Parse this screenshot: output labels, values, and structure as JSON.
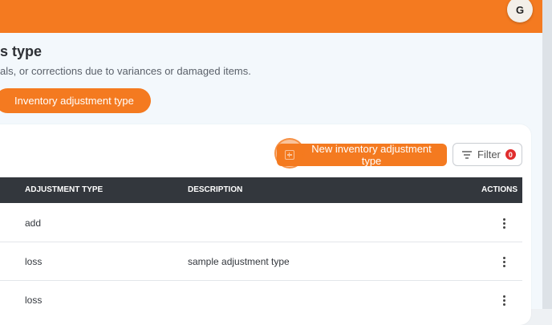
{
  "header": {
    "avatar_initial": "G",
    "brand_color": "#f47a20"
  },
  "page": {
    "title": "s type",
    "description": "als, or corrections due to variances or damaged items."
  },
  "tab_button": {
    "label": "Inventory adjustment type"
  },
  "toolbar": {
    "new_label": "New inventory adjustment type",
    "new_icon": "plus-square-icon",
    "filter_label": "Filter",
    "filter_icon": "filter-lines-icon",
    "filter_count": "0"
  },
  "table": {
    "columns": [
      "ADJUSTMENT TYPE",
      "DESCRIPTION",
      "ACTIONS"
    ],
    "rows": [
      {
        "type": "add",
        "description": ""
      },
      {
        "type": "loss",
        "description": "sample adjustment type"
      },
      {
        "type": "loss",
        "description": ""
      }
    ],
    "row_action_icon": "kebab-menu-icon"
  }
}
